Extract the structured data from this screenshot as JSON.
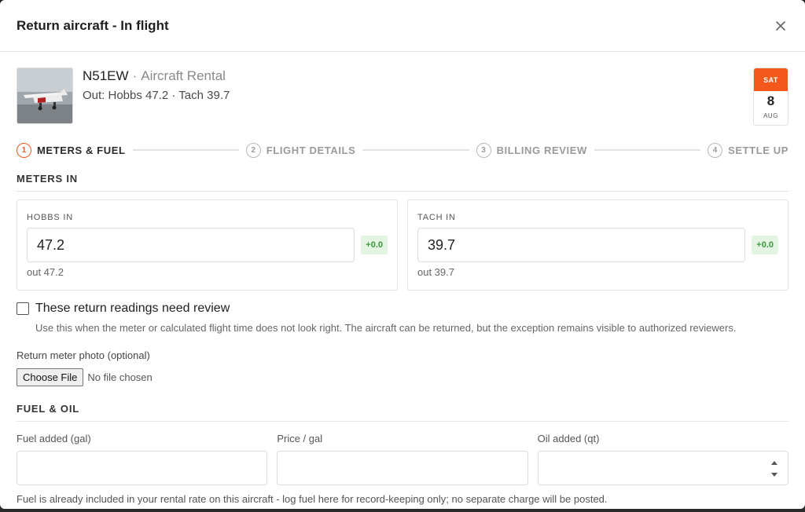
{
  "modal": {
    "title": "Return aircraft - In flight"
  },
  "aircraft": {
    "registration": "N51EW",
    "separator": "·",
    "type": "Aircraft Rental",
    "out_line": "Out: Hobbs 47.2 · Tach 39.7"
  },
  "date": {
    "dow": "SAT",
    "day": "8",
    "month": "AUG"
  },
  "steps": [
    {
      "num": "1",
      "label": "Meters & Fuel",
      "active": true
    },
    {
      "num": "2",
      "label": "Flight Details",
      "active": false
    },
    {
      "num": "3",
      "label": "Billing Review",
      "active": false
    },
    {
      "num": "4",
      "label": "Settle Up",
      "active": false
    }
  ],
  "meters_section": {
    "title": "Meters In"
  },
  "hobbs": {
    "label": "Hobbs In",
    "value": "47.2",
    "delta": "+0.0",
    "out": "out 47.2"
  },
  "tach": {
    "label": "Tach In",
    "value": "39.7",
    "delta": "+0.0",
    "out": "out 39.7"
  },
  "review": {
    "label": "These return readings need review",
    "help": "Use this when the meter or calculated flight time does not look right. The aircraft can be returned, but the exception remains visible to authorized reviewers.",
    "checked": false
  },
  "photo": {
    "label": "Return meter photo (optional)",
    "button": "Choose File",
    "status": "No file chosen"
  },
  "fuel_section": {
    "title": "Fuel & Oil"
  },
  "fuel": {
    "fuel_added_label": "Fuel added (gal)",
    "fuel_added_value": "",
    "price_label": "Price / gal",
    "price_value": "",
    "oil_label": "Oil added (qt)",
    "oil_value": "",
    "note": "Fuel is already included in your rental rate on this aircraft - log fuel here for record-keeping only; no separate charge will be posted."
  },
  "colors": {
    "accent": "#f4581c",
    "delta_bg": "#e4f4e3",
    "delta_text": "#3c9a3c"
  },
  "icons": {
    "close": "close-icon",
    "thumbnail": "aircraft-photo"
  }
}
